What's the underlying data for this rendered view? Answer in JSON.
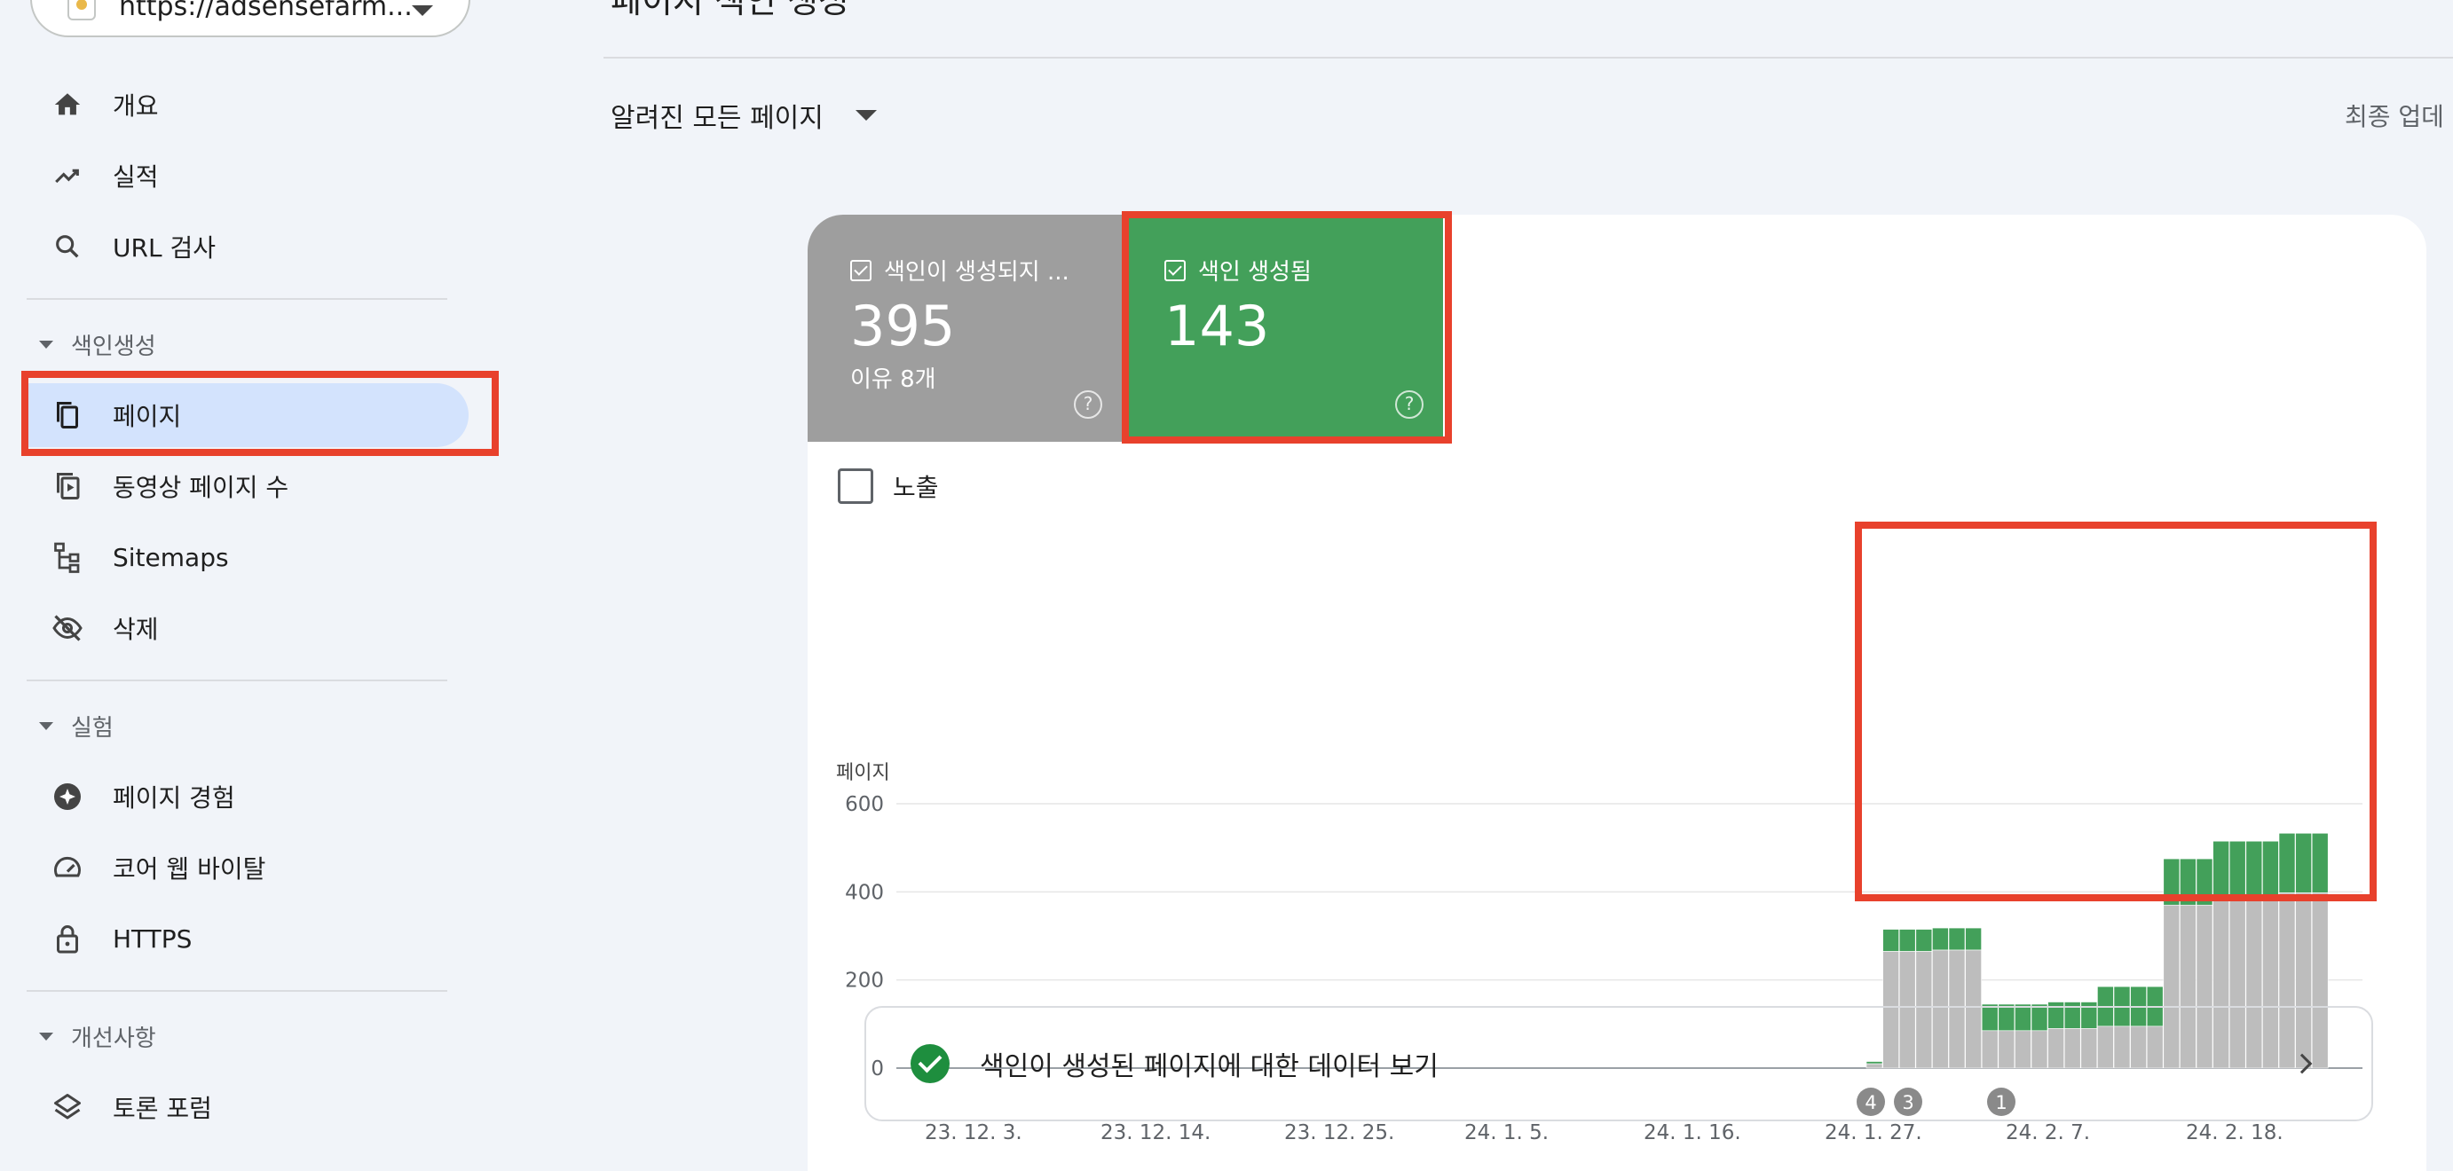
{
  "sidebar": {
    "property": {
      "url": "https://adsensefarm..."
    },
    "items_top": [
      {
        "label": "개요",
        "icon": "home-icon"
      },
      {
        "label": "실적",
        "icon": "trending-up-icon"
      },
      {
        "label": "URL 검사",
        "icon": "search-icon"
      }
    ],
    "sections": {
      "indexing": "색인생성",
      "experience": "실험",
      "enhancements": "개선사항"
    },
    "indexing_items": [
      {
        "label": "페이지",
        "icon": "pages-icon"
      },
      {
        "label": "동영상 페이지 수",
        "icon": "video-pages-icon"
      },
      {
        "label": "Sitemaps",
        "icon": "sitemap-icon"
      },
      {
        "label": "삭제",
        "icon": "visibility-off-icon"
      }
    ],
    "experience_items": [
      {
        "label": "페이지 경험",
        "icon": "page-experience-icon"
      },
      {
        "label": "코어 웹 바이탈",
        "icon": "speed-gauge-icon"
      },
      {
        "label": "HTTPS",
        "icon": "lock-icon"
      }
    ],
    "enhancement_items": [
      {
        "label": "토론 포럼",
        "icon": "layers-icon"
      }
    ]
  },
  "header": {
    "title": "페이지 색인 생성",
    "filter_label": "알려진 모든 페이지",
    "last_updated": "최종 업데"
  },
  "tiles": {
    "not_indexed": {
      "label": "색인이 생성되지 ...",
      "value": "395",
      "sub": "이유 8개"
    },
    "indexed": {
      "label": "색인 생성됨",
      "value": "143"
    }
  },
  "impressions_label": "노출",
  "data_link_label": "색인이 생성된 페이지에 대한 데이터 보기",
  "colors": {
    "indexed": "#43a05a",
    "not_indexed": "#bdbdbd",
    "highlight": "#e8412c",
    "nav_active": "#d3e3fd"
  },
  "chart_data": {
    "type": "bar",
    "stacked": true,
    "ylabel": "페이지",
    "ylim": [
      0,
      600
    ],
    "yticks": [
      0,
      200,
      400,
      600
    ],
    "xtick_labels": [
      "23. 12. 3.",
      "23. 12. 14.",
      "23. 12. 25.",
      "24. 1. 5.",
      "24. 1. 16.",
      "24. 1. 27.",
      "24. 2. 7.",
      "24. 2. 18."
    ],
    "series": [
      {
        "name": "색인이 생성되지 않음",
        "color": "#bdbdbd",
        "values": [
          10,
          265,
          265,
          265,
          268,
          268,
          268,
          85,
          85,
          85,
          85,
          90,
          90,
          90,
          95,
          95,
          95,
          95,
          370,
          370,
          370,
          380,
          380,
          380,
          380,
          398,
          398,
          398
        ]
      },
      {
        "name": "색인 생성됨",
        "color": "#43a05a",
        "values": [
          5,
          50,
          50,
          50,
          50,
          50,
          50,
          60,
          60,
          60,
          60,
          60,
          60,
          60,
          90,
          90,
          90,
          90,
          105,
          105,
          105,
          135,
          135,
          135,
          135,
          135,
          135,
          135
        ]
      }
    ],
    "annotations": [
      "4",
      "3",
      "1"
    ]
  }
}
